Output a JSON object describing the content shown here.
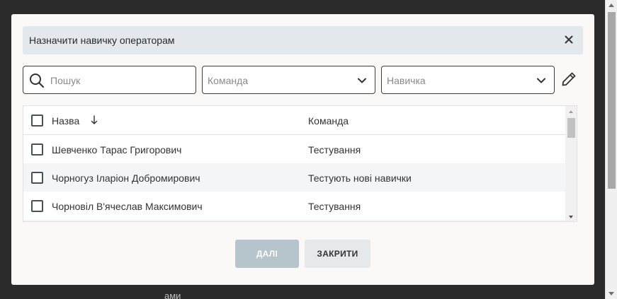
{
  "background": {
    "hint_text": "ами"
  },
  "modal": {
    "title": "Назначити навичку операторам",
    "close_icon": "close-icon"
  },
  "filters": {
    "search_placeholder": "Пошук",
    "team_placeholder": "Команда",
    "skill_placeholder": "Навичка",
    "edit_icon": "pencil-icon"
  },
  "table": {
    "columns": {
      "name": "Назва",
      "team": "Команда"
    },
    "sort_icon": "arrow-down-icon",
    "rows": [
      {
        "name": "Шевченко Тарас Григорович",
        "team": "Тестування",
        "checked": false
      },
      {
        "name": "Чорногуз Іларіон Добромирович",
        "team": "Тестують нові навички",
        "checked": false
      },
      {
        "name": "Чорновіл В'ячеслав Максимович",
        "team": "Тестування",
        "checked": false
      }
    ]
  },
  "buttons": {
    "next_label": "ДАЛІ",
    "close_label": "ЗАКРИТИ"
  },
  "colors": {
    "header_bg": "#e3e8ec",
    "stripe_bg": "#f3f5f7",
    "next_disabled_bg": "#b6c4cc",
    "close_bg": "#e5e9ec"
  }
}
